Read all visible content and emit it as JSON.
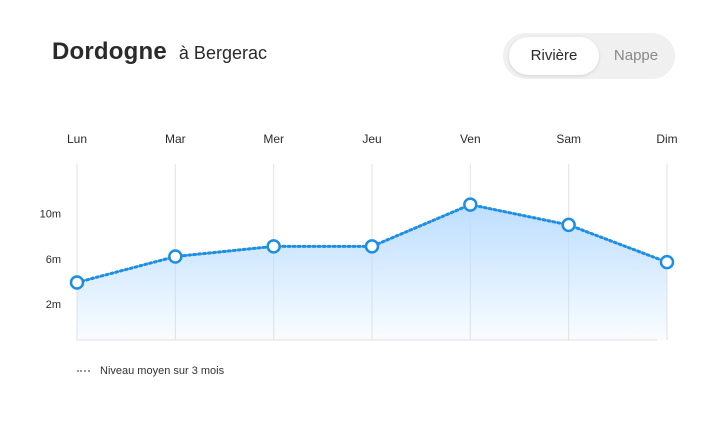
{
  "header": {
    "title": "Dordogne",
    "subtitle": "à Bergerac"
  },
  "toggle": {
    "options": [
      "Rivière",
      "Nappe"
    ],
    "selected": "Rivière"
  },
  "legend": {
    "label": "Niveau moyen sur 3 mois"
  },
  "colors": {
    "line": "#1e8ee0",
    "area_top": "#b9dcff",
    "grid": "#e2e2e2",
    "marker_fill": "#ffffff"
  },
  "chart_data": {
    "type": "line",
    "categories": [
      "Lun",
      "Mar",
      "Mer",
      "Jeu",
      "Ven",
      "Sam",
      "Dim"
    ],
    "series": [
      {
        "values": [
          3.9,
          6.2,
          7.1,
          7.1,
          10.8,
          9.0,
          5.7
        ]
      }
    ],
    "yticks": [
      {
        "value": 2,
        "label": "2m"
      },
      {
        "value": 6,
        "label": "6m"
      },
      {
        "value": 10,
        "label": "10m"
      }
    ],
    "ylim": [
      -1.2,
      14.4
    ],
    "line_style": "dotted",
    "area_fill": true,
    "grid": "vertical",
    "title": "",
    "xlabel": "",
    "ylabel": ""
  }
}
